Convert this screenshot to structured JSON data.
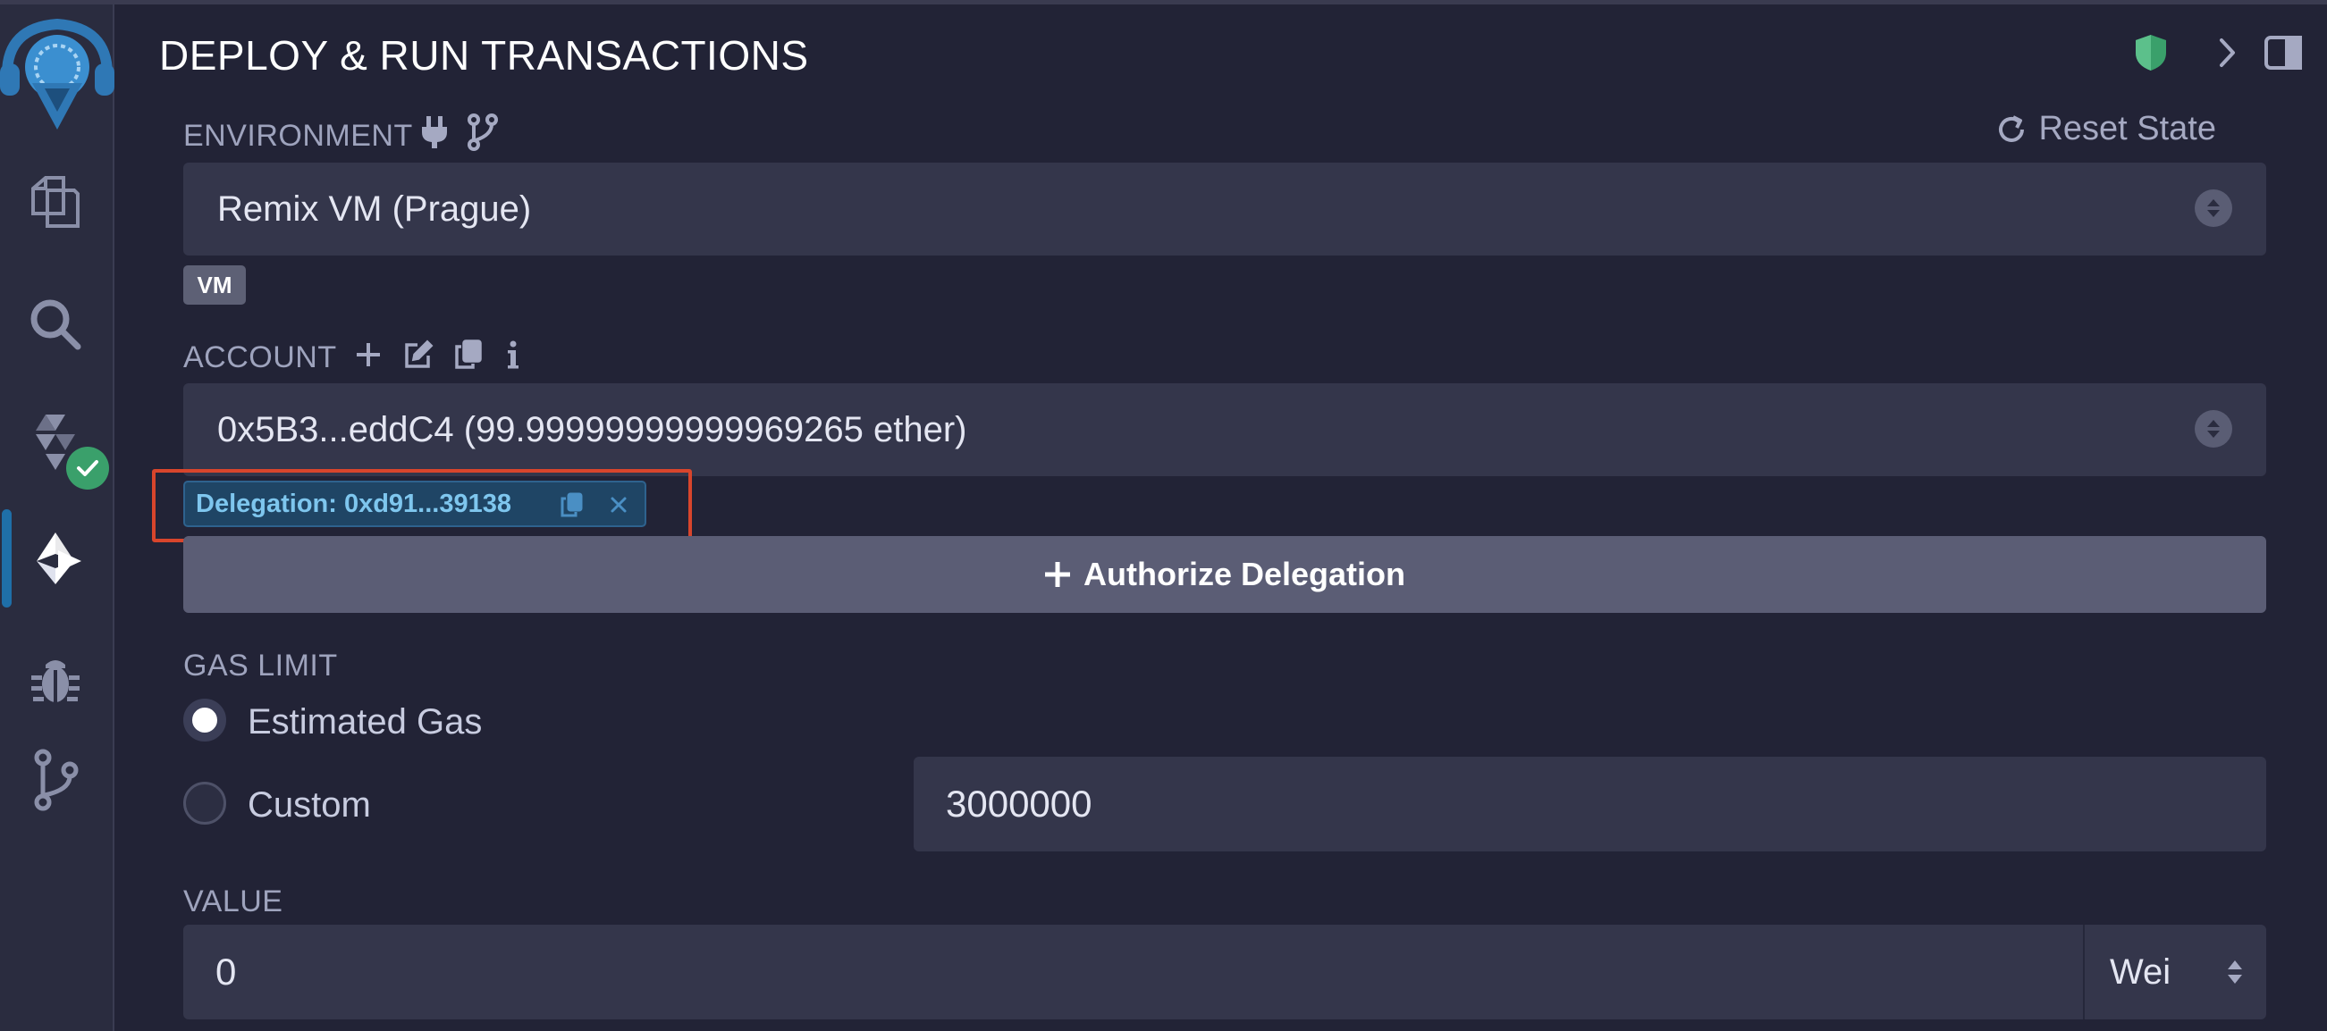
{
  "panel": {
    "title": "DEPLOY & RUN TRANSACTIONS"
  },
  "environment": {
    "label": "ENVIRONMENT",
    "reset_label": "Reset State",
    "selected": "Remix VM (Prague)",
    "badge": "VM"
  },
  "account": {
    "label": "ACCOUNT",
    "selected": "0x5B3...eddC4 (99.99999999999969265 ether)",
    "delegation": "Delegation: 0xd91...39138",
    "authorize_label": "Authorize Delegation"
  },
  "gas": {
    "label": "GAS LIMIT",
    "estimated_label": "Estimated Gas",
    "custom_label": "Custom",
    "custom_value": "3000000",
    "selected_option": "Estimated Gas"
  },
  "value": {
    "label": "VALUE",
    "amount": "0",
    "unit": "Wei"
  },
  "sidebar": {
    "items": [
      "file-explorer-icon",
      "search-icon",
      "solidity-compiler-icon",
      "deploy-run-icon",
      "debugger-icon",
      "git-icon"
    ],
    "active": "deploy-run-icon"
  },
  "colors": {
    "background": "#222336",
    "sidebar": "#2a2c3f",
    "input": "#34364b",
    "button": "#5b5d75",
    "delegation_chip": "#1f4565",
    "delegation_text": "#7ec6ee",
    "highlight": "#d8452c",
    "shield": "#3aa06b"
  }
}
